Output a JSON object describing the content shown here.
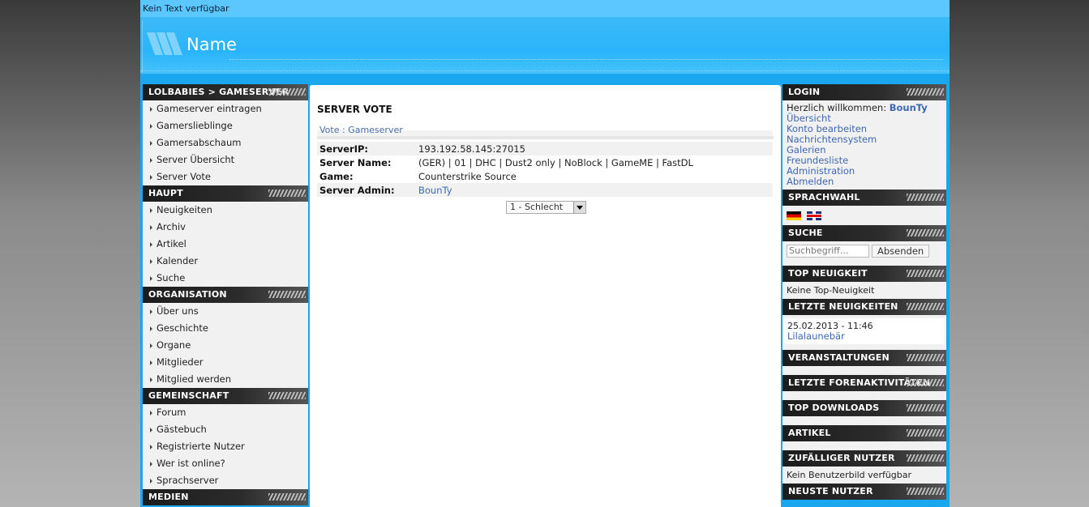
{
  "topbar": {
    "text": "Kein Text verfügbar"
  },
  "banner": {
    "title": "Name"
  },
  "left_nav": {
    "sections": [
      {
        "title": "LOLBABIES > GAMESERVER",
        "items": [
          "Gameserver eintragen",
          "Gamerslieblinge",
          "Gamersabschaum",
          "Server Übersicht",
          "Server Vote"
        ]
      },
      {
        "title": "HAUPT",
        "items": [
          "Neuigkeiten",
          "Archiv",
          "Artikel",
          "Kalender",
          "Suche"
        ]
      },
      {
        "title": "ORGANISATION",
        "items": [
          "Über uns",
          "Geschichte",
          "Organe",
          "Mitglieder",
          "Mitglied werden"
        ]
      },
      {
        "title": "GEMEINSCHAFT",
        "items": [
          "Forum",
          "Gästebuch",
          "Registrierte Nutzer",
          "Wer ist online?",
          "Sprachserver"
        ]
      },
      {
        "title": "MEDIEN",
        "items": []
      }
    ]
  },
  "content": {
    "heading": "SERVER VOTE",
    "breadcrumb": "Vote : Gameserver",
    "rows": [
      {
        "key": "ServerIP:",
        "value": "193.192.58.145:27015"
      },
      {
        "key": "Server Name:",
        "value": "(GER) | 01 | DHC | Dust2 only | NoBlock | GameME | FastDL"
      },
      {
        "key": "Game:",
        "value": "Counterstrike Source"
      },
      {
        "key": "Server Admin:",
        "value": "BounTy"
      }
    ],
    "vote_select": "1 - Schlecht"
  },
  "right": {
    "login": {
      "title": "LOGIN",
      "welcome_text": "Herzlich willkommen:",
      "user": "BounTy",
      "links": [
        "Übersicht",
        "Konto bearbeiten",
        "Nachrichtensystem",
        "Galerien",
        "Freundesliste",
        "Administration",
        "Abmelden"
      ]
    },
    "language": {
      "title": "SPRACHWAHL"
    },
    "search": {
      "title": "SUCHE",
      "placeholder": "Suchbegriff...",
      "button": "Absenden"
    },
    "top_news": {
      "title": "TOP NEUIGKEIT",
      "text": "Keine Top-Neuigkeit"
    },
    "latest_news": {
      "title": "LETZTE NEUIGKEITEN",
      "date": "25.02.2013 - 11:46",
      "link": "Lilalaunebär"
    },
    "events": {
      "title": "VERANSTALTUNGEN"
    },
    "forum": {
      "title": "LETZTE FORENAKTIVITÄTEN"
    },
    "downloads": {
      "title": "TOP DOWNLOADS"
    },
    "articles": {
      "title": "ARTIKEL"
    },
    "random_user": {
      "title": "ZUFÄLLIGER NUTZER",
      "text": "Kein Benutzerbild verfügbar"
    },
    "newest_user": {
      "title": "NEUSTE NUTZER"
    }
  },
  "colors": {
    "header_blue": "#1aa7ef",
    "link": "#3e67b0",
    "section_dark": "#1c1c1c"
  },
  "icons": [
    "arrow-bullet-icon",
    "flag-de-icon",
    "flag-uk-icon",
    "dropdown-arrow-icon"
  ]
}
